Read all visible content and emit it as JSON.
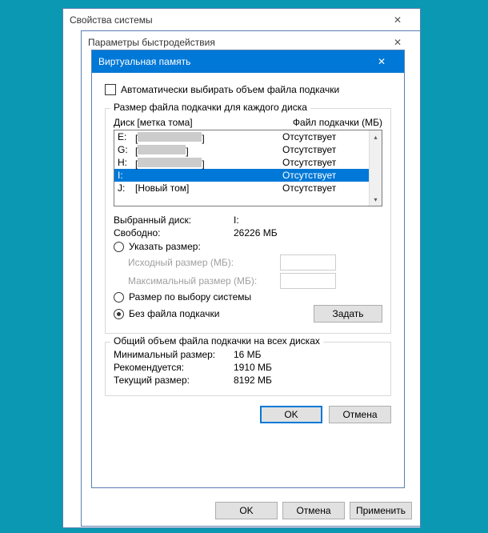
{
  "win1": {
    "title": "Свойства системы"
  },
  "win2": {
    "title": "Параметры быстродействия",
    "buttons": {
      "ok": "OK",
      "cancel": "Отмена",
      "apply": "Применить"
    }
  },
  "win3": {
    "title": "Виртуальная память",
    "auto_checkbox": "Автоматически выбирать объем файла подкачки",
    "group1_legend": "Размер файла подкачки для каждого диска",
    "col_disk": "Диск [метка тома]",
    "col_pfile": "Файл подкачки (МБ)",
    "rows": [
      {
        "letter": "E:",
        "label": "",
        "status": "Отсутствует",
        "redacted": true
      },
      {
        "letter": "G:",
        "label": "",
        "status": "Отсутствует",
        "redacted": true,
        "small": true
      },
      {
        "letter": "H:",
        "label": "",
        "status": "Отсутствует",
        "redacted": true
      },
      {
        "letter": "I:",
        "label": "",
        "status": "Отсутствует",
        "selected": true
      },
      {
        "letter": "J:",
        "label": "[Новый том]",
        "status": "Отсутствует"
      }
    ],
    "selected_disk_label": "Выбранный диск:",
    "selected_disk_value": "I:",
    "free_label": "Свободно:",
    "free_value": "26226 МБ",
    "radio_custom": "Указать размер:",
    "initial_size": "Исходный размер (МБ):",
    "max_size": "Максимальный размер (МБ):",
    "radio_system": "Размер по выбору системы",
    "radio_none": "Без файла подкачки",
    "set_button": "Задать",
    "group2_legend": "Общий объем файла подкачки на всех дисках",
    "min_label": "Минимальный размер:",
    "min_value": "16 МБ",
    "rec_label": "Рекомендуется:",
    "rec_value": "1910 МБ",
    "cur_label": "Текущий размер:",
    "cur_value": "8192 МБ",
    "ok": "OK",
    "cancel": "Отмена"
  }
}
